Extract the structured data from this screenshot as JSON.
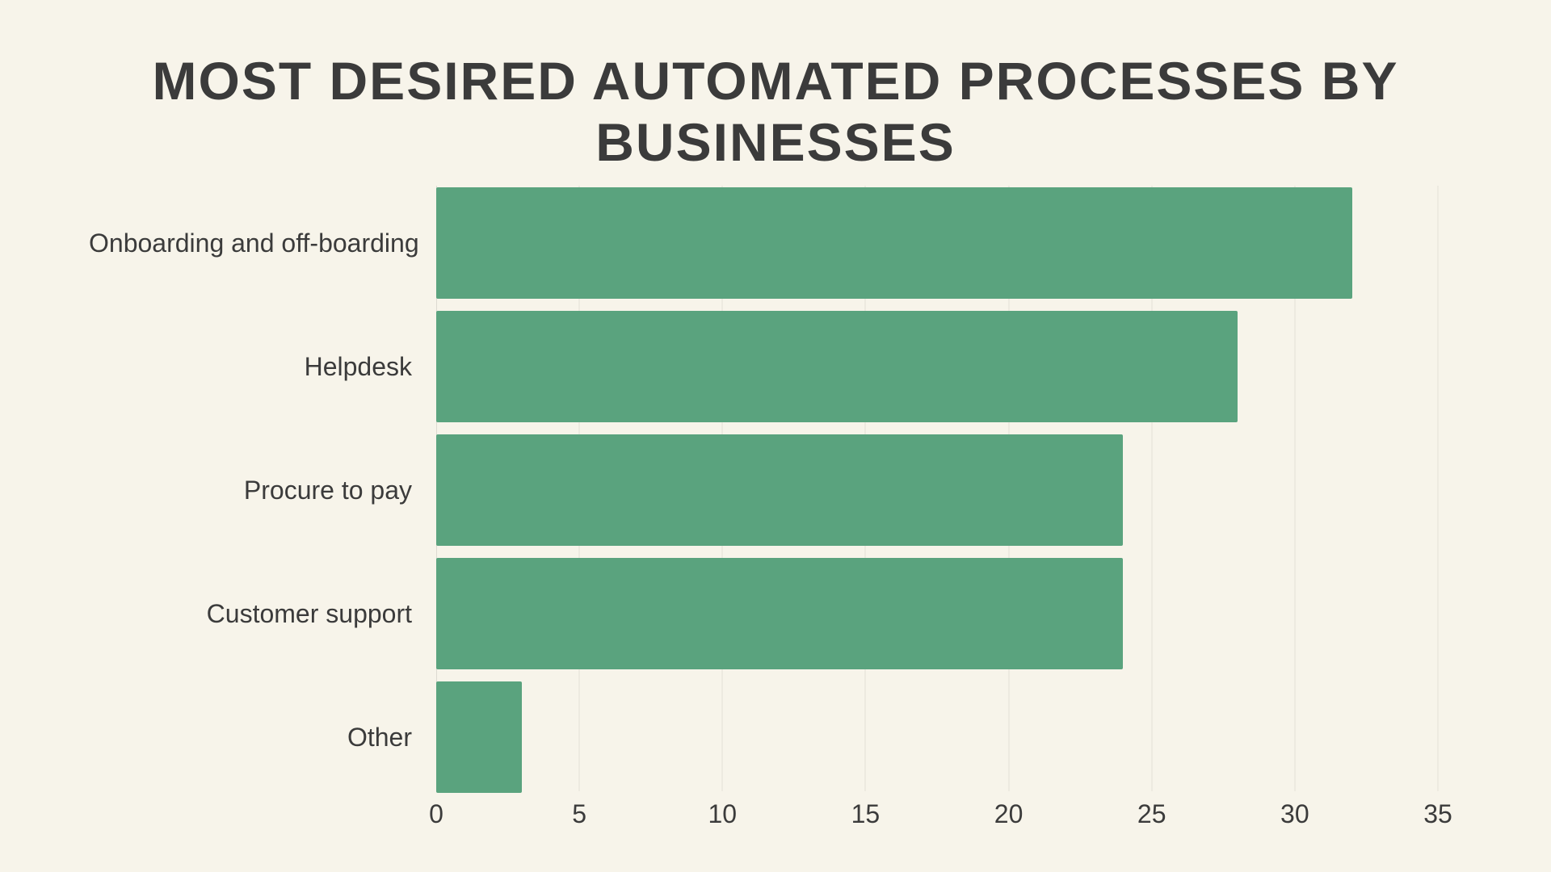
{
  "title": "MOST DESIRED AUTOMATED PROCESSES BY BUSINESSES",
  "chart_data": {
    "type": "bar",
    "orientation": "horizontal",
    "categories": [
      "Onboarding and off-boarding",
      "Helpdesk",
      "Procure to pay",
      "Customer support",
      "Other"
    ],
    "values": [
      32,
      28,
      24,
      24,
      3
    ],
    "title": "MOST DESIRED AUTOMATED PROCESSES BY BUSINESSES",
    "xlabel": "",
    "ylabel": "",
    "xlim": [
      0,
      35
    ],
    "xticks": [
      0,
      5,
      10,
      15,
      20,
      25,
      30,
      35
    ],
    "bar_color": "#5aa37e",
    "background": "#f7f4ea"
  }
}
